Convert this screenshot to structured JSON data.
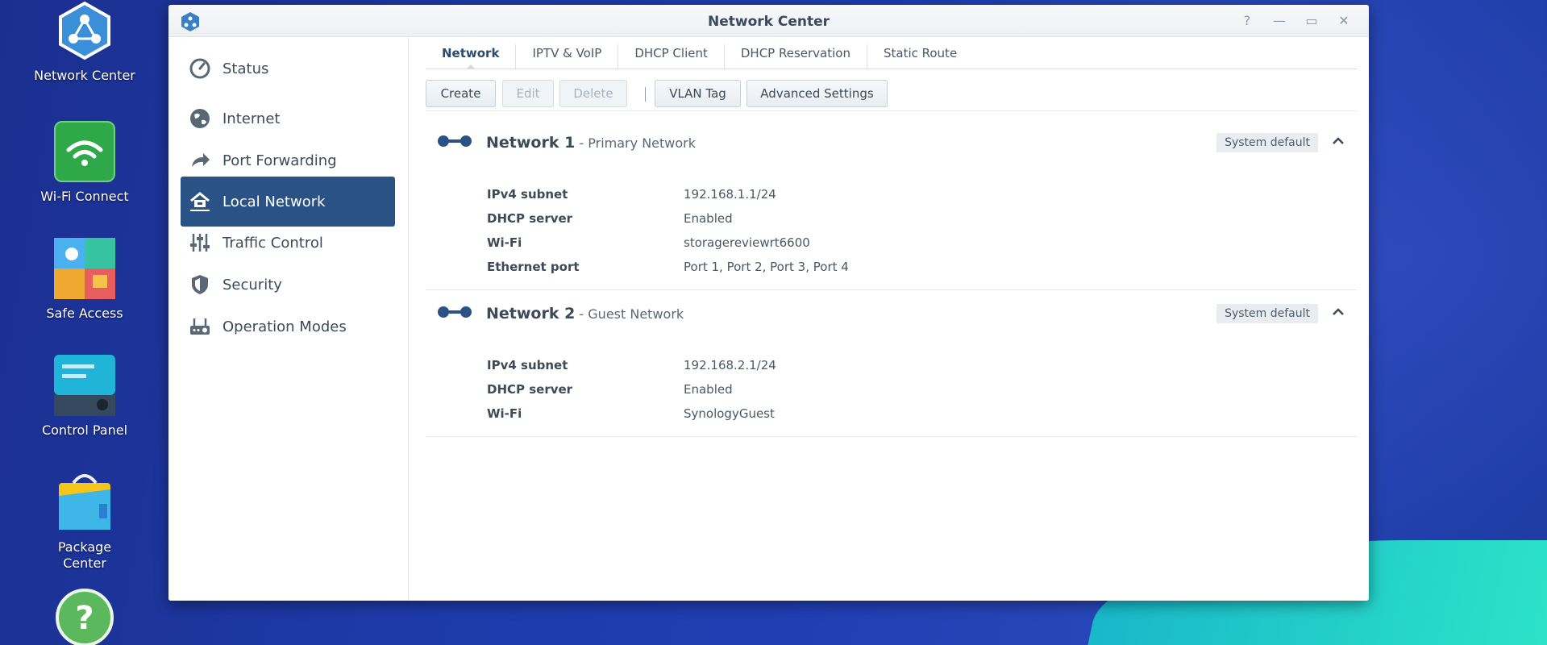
{
  "desktop": {
    "icons": [
      {
        "label": "Network Center"
      },
      {
        "label": "Wi-Fi Connect"
      },
      {
        "label": "Safe Access"
      },
      {
        "label": "Control Panel"
      },
      {
        "label": "Package\nCenter"
      },
      {
        "label": ""
      }
    ]
  },
  "window": {
    "title": "Network Center",
    "controls": {
      "help": "?",
      "minimize": "—",
      "maximize": "▭",
      "close": "✕"
    }
  },
  "sidebar": {
    "items": [
      {
        "label": "Status",
        "icon": "gauge-icon"
      },
      {
        "label": "Internet",
        "icon": "globe-icon"
      },
      {
        "label": "Port Forwarding",
        "icon": "forward-arrow-icon"
      },
      {
        "label": "Local Network",
        "icon": "home-network-icon",
        "active": true
      },
      {
        "label": "Traffic Control",
        "icon": "sliders-icon"
      },
      {
        "label": "Security",
        "icon": "shield-icon"
      },
      {
        "label": "Operation Modes",
        "icon": "router-icon"
      }
    ]
  },
  "tabs": [
    {
      "label": "Network",
      "active": true
    },
    {
      "label": "IPTV & VoIP"
    },
    {
      "label": "DHCP Client"
    },
    {
      "label": "DHCP Reservation"
    },
    {
      "label": "Static Route"
    }
  ],
  "toolbar": {
    "create": "Create",
    "edit": "Edit",
    "delete": "Delete",
    "vlan": "VLAN Tag",
    "advanced": "Advanced Settings"
  },
  "networks": [
    {
      "name": "Network 1",
      "subtitle": " - Primary Network",
      "badge": "System default",
      "rows": [
        {
          "key": "IPv4 subnet",
          "value": "192.168.1.1/24"
        },
        {
          "key": "DHCP server",
          "value": "Enabled"
        },
        {
          "key": "Wi-Fi",
          "value": "storagereviewrt6600"
        },
        {
          "key": "Ethernet port",
          "value": "Port 1, Port 2, Port 3, Port 4"
        }
      ]
    },
    {
      "name": "Network 2",
      "subtitle": " - Guest Network",
      "badge": "System default",
      "rows": [
        {
          "key": "IPv4 subnet",
          "value": "192.168.2.1/24"
        },
        {
          "key": "DHCP server",
          "value": "Enabled"
        },
        {
          "key": "Wi-Fi",
          "value": "SynologyGuest"
        }
      ]
    }
  ],
  "colors": {
    "accent": "#2b5285",
    "net_icon": "#2b5285"
  }
}
